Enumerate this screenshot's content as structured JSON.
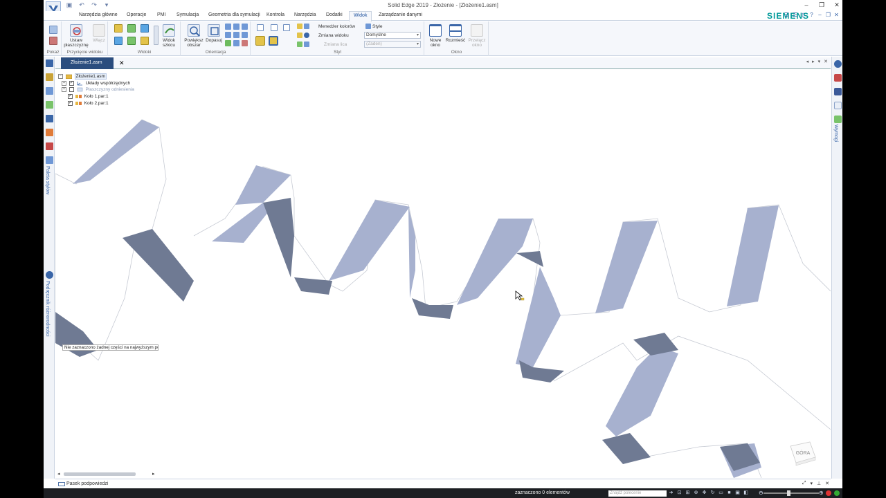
{
  "window": {
    "title": "Solid Edge 2019 - Złożenie - [Złożenie1.asm]"
  },
  "tabs": [
    {
      "label": "Narzędzia główne"
    },
    {
      "label": "Operacje"
    },
    {
      "label": "PMI"
    },
    {
      "label": "Symulacja"
    },
    {
      "label": "Geometria dla symulacji"
    },
    {
      "label": "Kontrola"
    },
    {
      "label": "Narzędzia"
    },
    {
      "label": "Dodatki"
    },
    {
      "label": "Widok"
    },
    {
      "label": "Zarządzanie danymi"
    }
  ],
  "brand": "SIEMENS",
  "ribbon": {
    "pokaz_group": "Pokaż",
    "przyciecie": {
      "ustaw": "Ustaw",
      "ustaw2": "płaszczyznę",
      "wlacz": "Włącz",
      "group": "Przycięcie widoku"
    },
    "widoki": {
      "widok_szkicu": "Widok",
      "widok_szkicu2": "szkicu",
      "group": "Widoki"
    },
    "orientacja": {
      "powieksz": "Powiększ",
      "powieksz2": "obszar",
      "dopasuj": "Dopasuj",
      "group": "Orientacja"
    },
    "styl": {
      "menedzer": "Menedżer kolorów",
      "style": "Style",
      "zmiana_widoku": "Zmiana widoku",
      "combo1": "Domyślne",
      "zmiana_lica": "Zmiana lica",
      "combo2": "(Żaden)",
      "group": "Styl"
    },
    "okno": {
      "nowe": "Nowe",
      "nowe2": "okno",
      "rozmiesc": "Rozmieść",
      "przelacz": "Przełącz",
      "przelacz2": "okno",
      "group": "Okno"
    }
  },
  "sidebars": {
    "paleta": "Paleta stylów",
    "podrecznik": "Podręcznik różnorodności",
    "wymogi": "Wymogi"
  },
  "document": {
    "tab_label": "Złożenie1.asm"
  },
  "tree": [
    {
      "label": "Złożenie1.asm"
    },
    {
      "label": "Układy współrzędnych"
    },
    {
      "label": "Płaszczyzny odniesienia"
    },
    {
      "label": "Koło 1.par:1"
    },
    {
      "label": "Koło 2.par:1"
    }
  ],
  "tooltip": "Nie zaznaczono żadnej części na najwyższym poziomie",
  "viewcube_label": "GÓRA",
  "prompt_bar": {
    "label": "Pasek podpowiedzi"
  },
  "status": {
    "selected": "zaznaczono 0 elementów",
    "search_placeholder": "Znajdź polecenie"
  },
  "colors": {
    "tooth_light": "#a7b1cf",
    "tooth_dark": "#6f7a93",
    "accent_blue": "#2b4d7e",
    "brand_teal": "#009999"
  }
}
